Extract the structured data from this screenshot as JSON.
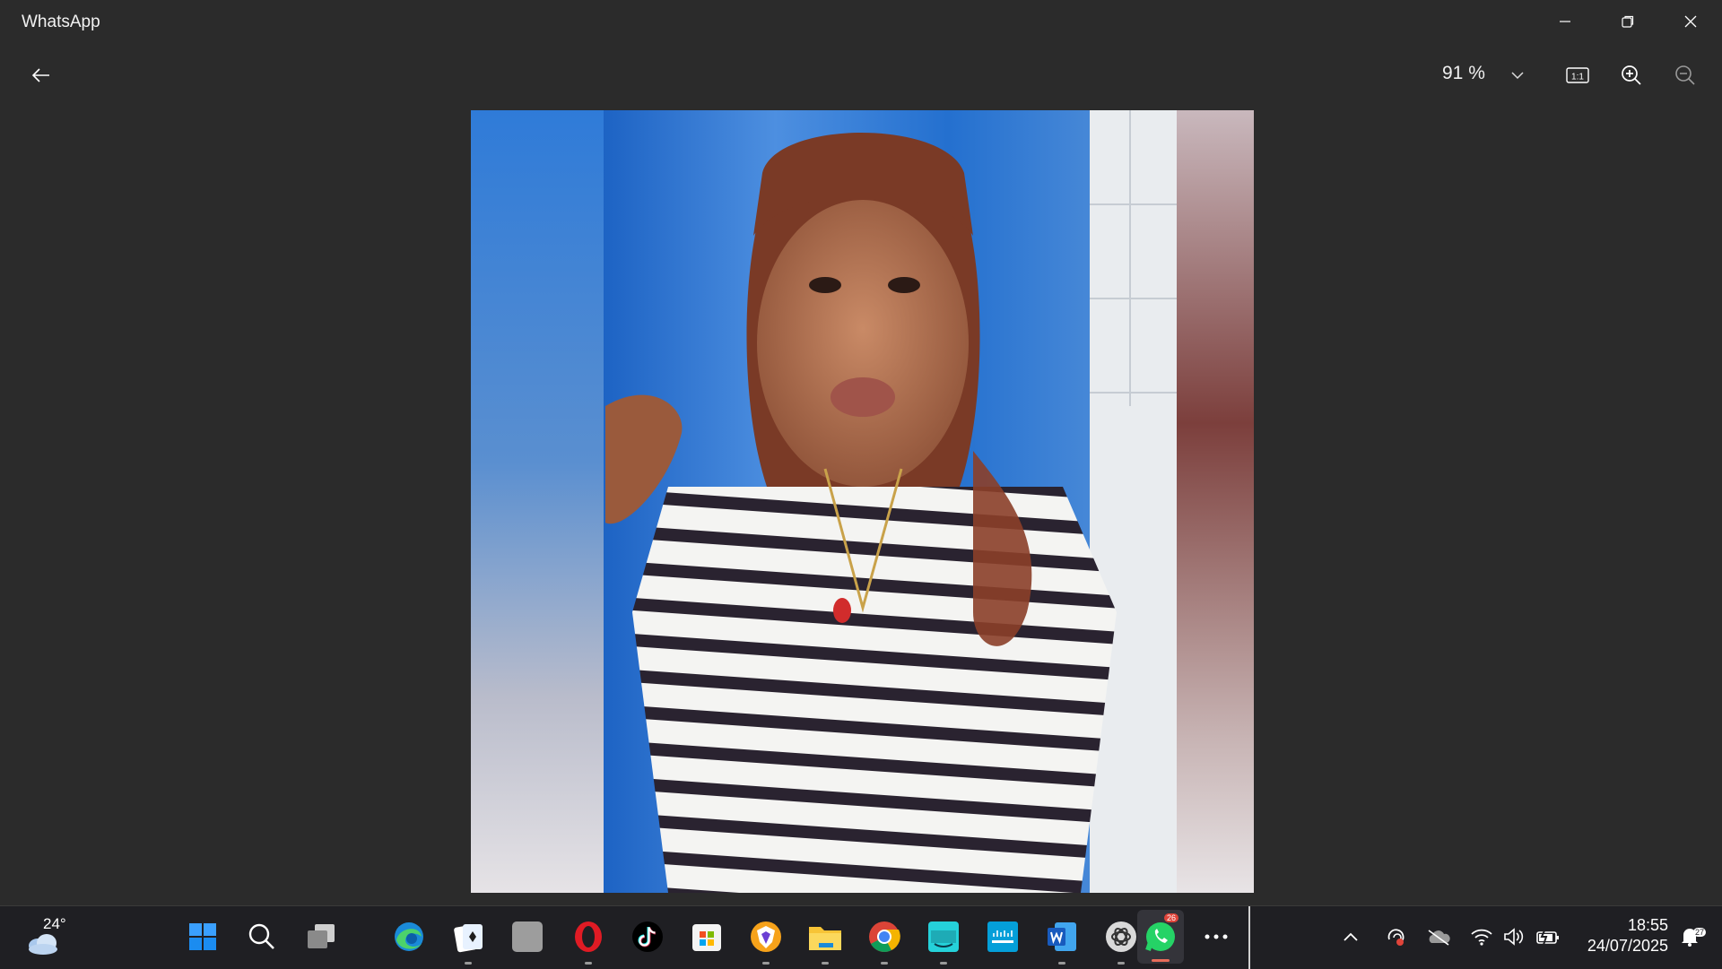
{
  "window": {
    "title": "WhatsApp"
  },
  "viewer": {
    "zoom_level": "91 %",
    "actual_size_label": "1:1"
  },
  "taskbar": {
    "weather": {
      "temperature": "24°",
      "icon": "cloudy-icon"
    },
    "pinned_apps": [
      "windows-start",
      "search",
      "task-view",
      "microsoft-edge",
      "solitaire",
      "blank-app",
      "opera",
      "tiktok",
      "microsoft-store",
      "brave",
      "file-explorer",
      "google-chrome",
      "amazon-music",
      "cisco-networking-academy",
      "microsoft-word",
      "chatgpt",
      "whatsapp"
    ],
    "whatsapp_badge": "26",
    "clock": {
      "time": "18:55",
      "date": "24/07/2025"
    },
    "notification_badge": "27"
  },
  "colors": {
    "title_bg": "#2b2b2b",
    "taskbar_bg": "#1f1f23",
    "accent_running": "#e86c5a"
  }
}
